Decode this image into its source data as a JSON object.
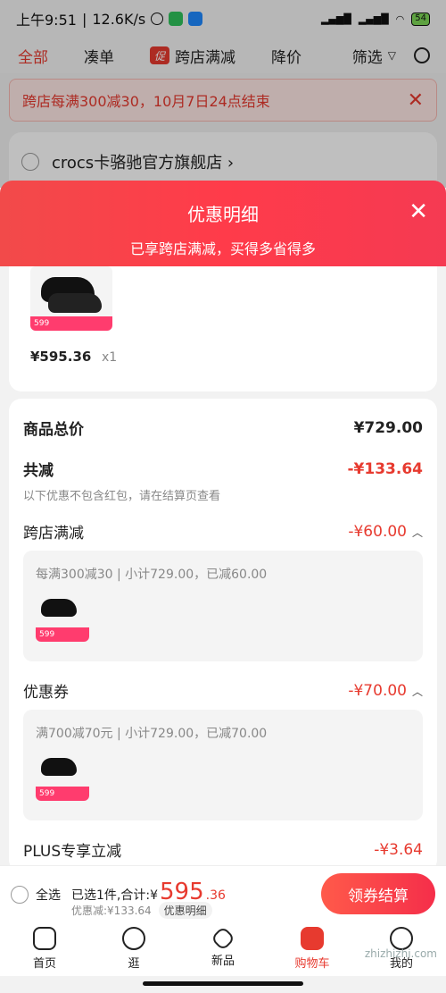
{
  "status": {
    "time": "上午9:51",
    "speed": "12.6K/s",
    "battery": "54"
  },
  "tabs": {
    "all": "全部",
    "combine": "凑单",
    "promo_badge": "促",
    "cross_store": "跨店满减",
    "price_drop": "降价",
    "filter": "筛选"
  },
  "notice": {
    "text": "跨店每满300减30，10月7日24点结束"
  },
  "store": {
    "name": "crocs卡骆驰官方旗舰店 ›"
  },
  "sheet": {
    "title": "优惠明细",
    "subtitle": "已享跨店满减，买得多省得多"
  },
  "product": {
    "price": "¥595.36",
    "qty": "x1",
    "brand": "crocs",
    "tag_price": "599"
  },
  "detail": {
    "total_label": "商品总价",
    "total_value": "¥729.00",
    "reduce_label": "共减",
    "reduce_value": "-¥133.64",
    "hint": "以下优惠不包含红包，请在结算页查看",
    "cross_label": "跨店满减",
    "cross_value": "-¥60.00",
    "cross_desc": "每满300减30 | 小计729.00，已减60.00",
    "coupon_label": "优惠券",
    "coupon_value": "-¥70.00",
    "coupon_desc": "满700减70元 | 小计729.00，已减70.00",
    "plus_label": "PLUS专享立减",
    "plus_value": "-¥3.64"
  },
  "checkout": {
    "select_all": "全选",
    "selected": "已选1件,合计:¥",
    "big": "595",
    "small": ".36",
    "discount": "优惠减:¥133.64",
    "detail_pill": "优惠明细",
    "pay": "领券结算"
  },
  "nav": [
    "首页",
    "逛",
    "新品",
    "购物车",
    "我的"
  ],
  "watermark": "zhizhizhi.com",
  "colors": {
    "accent": "#e73a2f",
    "sheet_red": "#f53a52"
  }
}
